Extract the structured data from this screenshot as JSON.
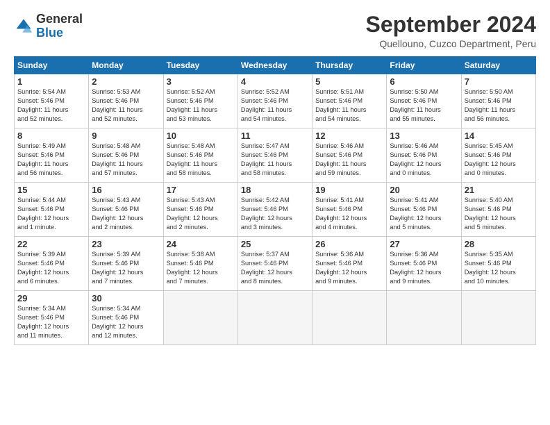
{
  "header": {
    "logo_line1": "General",
    "logo_line2": "Blue",
    "month_title": "September 2024",
    "subtitle": "Quellouno, Cuzco Department, Peru"
  },
  "weekdays": [
    "Sunday",
    "Monday",
    "Tuesday",
    "Wednesday",
    "Thursday",
    "Friday",
    "Saturday"
  ],
  "weeks": [
    [
      {
        "day": "1",
        "info": "Sunrise: 5:54 AM\nSunset: 5:46 PM\nDaylight: 11 hours\nand 52 minutes."
      },
      {
        "day": "2",
        "info": "Sunrise: 5:53 AM\nSunset: 5:46 PM\nDaylight: 11 hours\nand 52 minutes."
      },
      {
        "day": "3",
        "info": "Sunrise: 5:52 AM\nSunset: 5:46 PM\nDaylight: 11 hours\nand 53 minutes."
      },
      {
        "day": "4",
        "info": "Sunrise: 5:52 AM\nSunset: 5:46 PM\nDaylight: 11 hours\nand 54 minutes."
      },
      {
        "day": "5",
        "info": "Sunrise: 5:51 AM\nSunset: 5:46 PM\nDaylight: 11 hours\nand 54 minutes."
      },
      {
        "day": "6",
        "info": "Sunrise: 5:50 AM\nSunset: 5:46 PM\nDaylight: 11 hours\nand 55 minutes."
      },
      {
        "day": "7",
        "info": "Sunrise: 5:50 AM\nSunset: 5:46 PM\nDaylight: 11 hours\nand 56 minutes."
      }
    ],
    [
      {
        "day": "8",
        "info": "Sunrise: 5:49 AM\nSunset: 5:46 PM\nDaylight: 11 hours\nand 56 minutes."
      },
      {
        "day": "9",
        "info": "Sunrise: 5:48 AM\nSunset: 5:46 PM\nDaylight: 11 hours\nand 57 minutes."
      },
      {
        "day": "10",
        "info": "Sunrise: 5:48 AM\nSunset: 5:46 PM\nDaylight: 11 hours\nand 58 minutes."
      },
      {
        "day": "11",
        "info": "Sunrise: 5:47 AM\nSunset: 5:46 PM\nDaylight: 11 hours\nand 58 minutes."
      },
      {
        "day": "12",
        "info": "Sunrise: 5:46 AM\nSunset: 5:46 PM\nDaylight: 11 hours\nand 59 minutes."
      },
      {
        "day": "13",
        "info": "Sunrise: 5:46 AM\nSunset: 5:46 PM\nDaylight: 12 hours\nand 0 minutes."
      },
      {
        "day": "14",
        "info": "Sunrise: 5:45 AM\nSunset: 5:46 PM\nDaylight: 12 hours\nand 0 minutes."
      }
    ],
    [
      {
        "day": "15",
        "info": "Sunrise: 5:44 AM\nSunset: 5:46 PM\nDaylight: 12 hours\nand 1 minute."
      },
      {
        "day": "16",
        "info": "Sunrise: 5:43 AM\nSunset: 5:46 PM\nDaylight: 12 hours\nand 2 minutes."
      },
      {
        "day": "17",
        "info": "Sunrise: 5:43 AM\nSunset: 5:46 PM\nDaylight: 12 hours\nand 2 minutes."
      },
      {
        "day": "18",
        "info": "Sunrise: 5:42 AM\nSunset: 5:46 PM\nDaylight: 12 hours\nand 3 minutes."
      },
      {
        "day": "19",
        "info": "Sunrise: 5:41 AM\nSunset: 5:46 PM\nDaylight: 12 hours\nand 4 minutes."
      },
      {
        "day": "20",
        "info": "Sunrise: 5:41 AM\nSunset: 5:46 PM\nDaylight: 12 hours\nand 5 minutes."
      },
      {
        "day": "21",
        "info": "Sunrise: 5:40 AM\nSunset: 5:46 PM\nDaylight: 12 hours\nand 5 minutes."
      }
    ],
    [
      {
        "day": "22",
        "info": "Sunrise: 5:39 AM\nSunset: 5:46 PM\nDaylight: 12 hours\nand 6 minutes."
      },
      {
        "day": "23",
        "info": "Sunrise: 5:39 AM\nSunset: 5:46 PM\nDaylight: 12 hours\nand 7 minutes."
      },
      {
        "day": "24",
        "info": "Sunrise: 5:38 AM\nSunset: 5:46 PM\nDaylight: 12 hours\nand 7 minutes."
      },
      {
        "day": "25",
        "info": "Sunrise: 5:37 AM\nSunset: 5:46 PM\nDaylight: 12 hours\nand 8 minutes."
      },
      {
        "day": "26",
        "info": "Sunrise: 5:36 AM\nSunset: 5:46 PM\nDaylight: 12 hours\nand 9 minutes."
      },
      {
        "day": "27",
        "info": "Sunrise: 5:36 AM\nSunset: 5:46 PM\nDaylight: 12 hours\nand 9 minutes."
      },
      {
        "day": "28",
        "info": "Sunrise: 5:35 AM\nSunset: 5:46 PM\nDaylight: 12 hours\nand 10 minutes."
      }
    ],
    [
      {
        "day": "29",
        "info": "Sunrise: 5:34 AM\nSunset: 5:46 PM\nDaylight: 12 hours\nand 11 minutes."
      },
      {
        "day": "30",
        "info": "Sunrise: 5:34 AM\nSunset: 5:46 PM\nDaylight: 12 hours\nand 12 minutes."
      },
      {
        "day": "",
        "info": ""
      },
      {
        "day": "",
        "info": ""
      },
      {
        "day": "",
        "info": ""
      },
      {
        "day": "",
        "info": ""
      },
      {
        "day": "",
        "info": ""
      }
    ]
  ]
}
